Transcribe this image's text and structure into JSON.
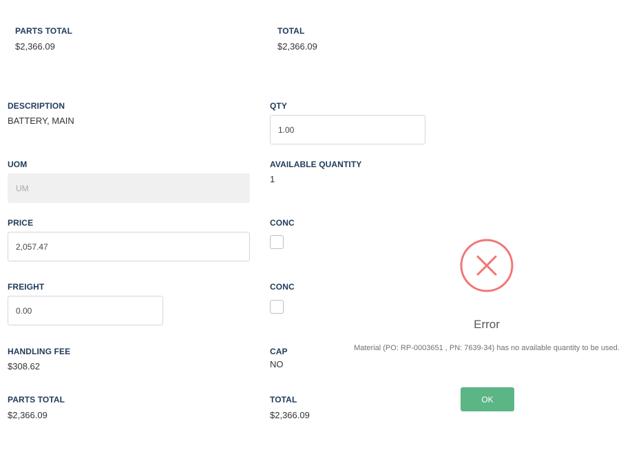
{
  "top_totals": {
    "parts_total_label": "PARTS TOTAL",
    "parts_total_value": "$2,366.09",
    "total_label": "TOTAL",
    "total_value": "$2,366.09"
  },
  "form": {
    "description_label": "DESCRIPTION",
    "description_value": "BATTERY, MAIN",
    "qty_label": "QTY",
    "qty_value": "1.00",
    "uom_label": "UOM",
    "uom_value": "UM",
    "available_quantity_label": "AVAILABLE QUANTITY",
    "available_quantity_value": "1",
    "price_label": "PRICE",
    "price_value": "2,057.47",
    "conc_label_1": "CONC",
    "conc_checked_1": false,
    "freight_label": "FREIGHT",
    "freight_value": "0.00",
    "conc_label_2": "CONC",
    "conc_checked_2": false,
    "handling_fee_label": "HANDLING FEE",
    "handling_fee_value": "$308.62",
    "cap_label": "CAP",
    "cap_value": "NO",
    "parts_total_label": "PARTS TOTAL",
    "parts_total_value": "$2,366.09",
    "total_label": "TOTAL",
    "total_value": "$2,366.09"
  },
  "error_dialog": {
    "icon": "error-x-circle-icon",
    "icon_color": "#f27474",
    "title": "Error",
    "message": "Material (PO: RP-0003651 , PN: 7639-34) has no available quantity to be used.",
    "ok_label": "OK",
    "ok_color": "#5cb585"
  }
}
